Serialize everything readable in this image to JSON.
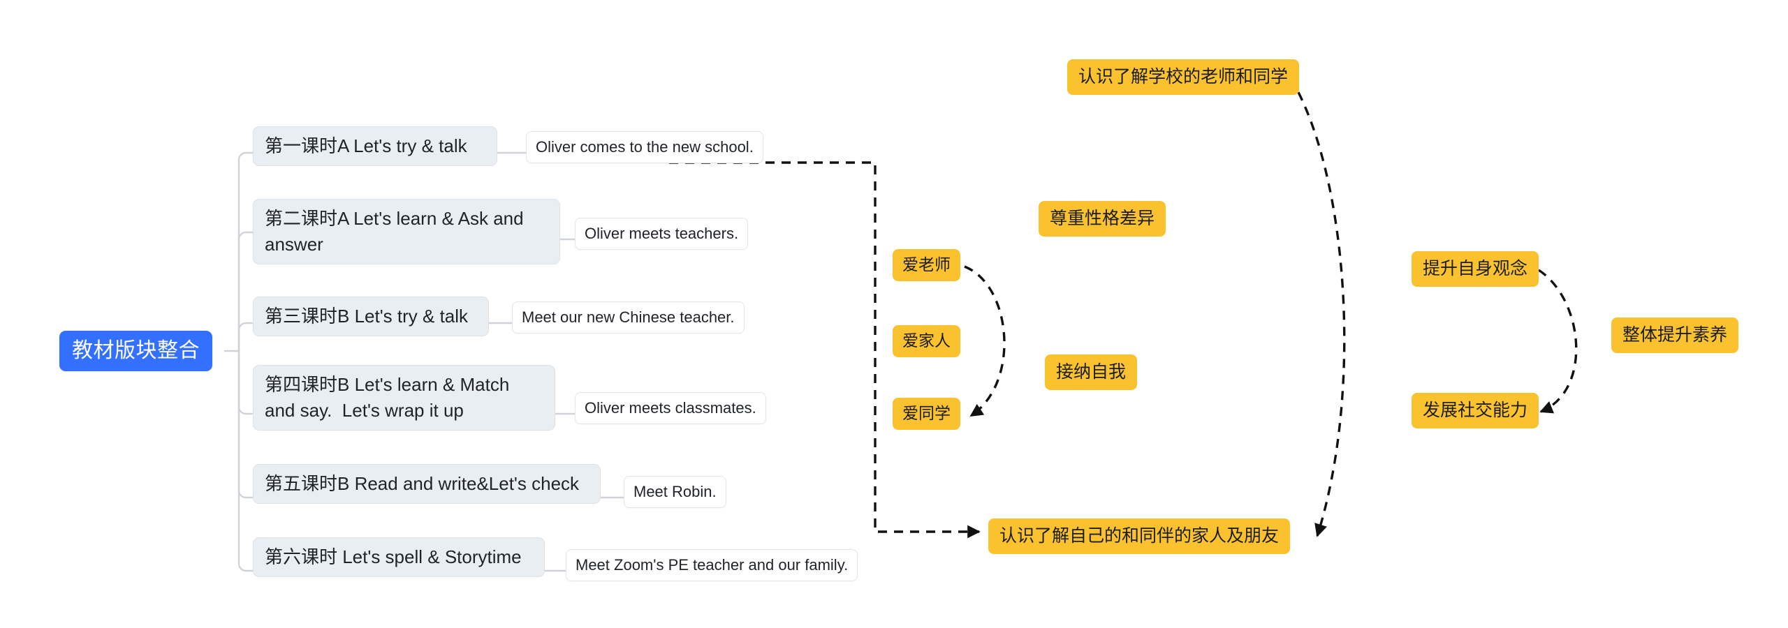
{
  "diagram": {
    "title": "教材版块整合",
    "type": "mindmap",
    "background": "#ffffff",
    "colors": {
      "root_fill": "#3370FF",
      "root_text": "#ffffff",
      "lesson_fill": "#E9EEF3",
      "lesson_border": "#DDE2E8",
      "sentence_fill": "#ffffff",
      "sentence_border": "#E2E5E9",
      "goal_fill": "#F9C22E",
      "goal_text": "#1c1c1c",
      "connector": "#CFD3D8",
      "dashed_connector": "#111111"
    }
  },
  "root": {
    "label": "教材版块整合"
  },
  "lessons": [
    {
      "label": "第一课时A Let's try & talk",
      "sentence": "Oliver comes to the new school."
    },
    {
      "label": "第二课时A Let's learn & Ask and answer",
      "sentence": "Oliver meets teachers."
    },
    {
      "label": "第三课时B Let's try & talk",
      "sentence": "Meet our new Chinese teacher."
    },
    {
      "label": "第四课时B Let's learn & Match and say.  Let's wrap it up",
      "sentence": "Oliver meets classmates."
    },
    {
      "label": "第五课时B Read and write&Let's check",
      "sentence": "Meet Robin."
    },
    {
      "label": "第六课时 Let's spell & Storytime",
      "sentence": "Meet Zoom's PE teacher and our family."
    }
  ],
  "goals": {
    "love_group": [
      {
        "label": "爱老师"
      },
      {
        "label": "爱家人"
      },
      {
        "label": "爱同学"
      }
    ],
    "middle_column": [
      {
        "label": "尊重性格差异"
      },
      {
        "label": "接纳自我"
      }
    ],
    "knowledge_top": {
      "label": "认识了解学校的老师和同学"
    },
    "knowledge_bottom": {
      "label": "认识了解自己的和同伴的家人及朋友"
    },
    "quality_group": [
      {
        "label": "提升自身观念"
      },
      {
        "label": "整体提升素养"
      },
      {
        "label": "发展社交能力"
      }
    ]
  }
}
